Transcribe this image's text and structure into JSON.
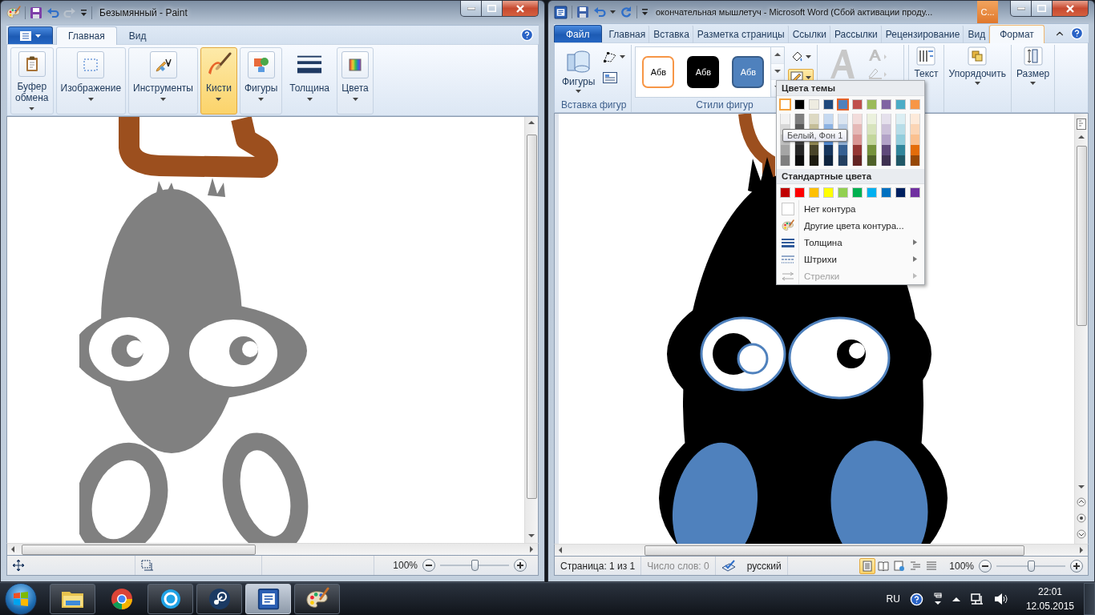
{
  "paint": {
    "title": "Безымянный - Paint",
    "tabs": [
      {
        "label": "Главная",
        "selected": true
      },
      {
        "label": "Вид",
        "selected": false
      }
    ],
    "groups": [
      {
        "label": "Буфер обмена",
        "kind": "clipboard",
        "selected": false
      },
      {
        "label": "Изображение",
        "kind": "select",
        "selected": false
      },
      {
        "label": "Инструменты",
        "kind": "tools",
        "selected": false
      },
      {
        "label": "Кисти",
        "kind": "brush",
        "selected": true
      },
      {
        "label": "Фигуры",
        "kind": "shapes",
        "selected": false
      },
      {
        "label": "Толщина",
        "kind": "size",
        "selected": false
      },
      {
        "label": "Цвета",
        "kind": "colors",
        "selected": false
      }
    ],
    "zoom": {
      "reading": "100%",
      "level": 0.5
    }
  },
  "word": {
    "title": "окончательная мышлетуч  -  Microsoft Word (Сбой активации проду...",
    "context_tab": "С...",
    "tabs": [
      {
        "label": "Файл",
        "kind": "file",
        "selected": false
      },
      {
        "label": "Главная",
        "kind": "normal",
        "selected": false
      },
      {
        "label": "Вставка",
        "kind": "normal",
        "selected": false
      },
      {
        "label": "Разметка страницы",
        "kind": "normal",
        "selected": false
      },
      {
        "label": "Ссылки",
        "kind": "normal",
        "selected": false
      },
      {
        "label": "Рассылки",
        "kind": "normal",
        "selected": false
      },
      {
        "label": "Рецензирование",
        "kind": "normal",
        "selected": false
      },
      {
        "label": "Вид",
        "kind": "normal",
        "selected": false
      },
      {
        "label": "Формат",
        "kind": "context",
        "selected": true
      }
    ],
    "insert_group": {
      "label": "Вставка фигур",
      "button": "Фигуры"
    },
    "styles_group": {
      "label": "Стили фигур",
      "styles": [
        {
          "text": "Абв",
          "kind": "outline"
        },
        {
          "text": "Абв",
          "kind": "black"
        },
        {
          "text": "Абв",
          "kind": "blue"
        }
      ]
    },
    "buttons": [
      {
        "label": "Текст",
        "kind": "text"
      },
      {
        "label": "Упорядочить",
        "kind": "arrange"
      },
      {
        "label": "Размер",
        "kind": "size"
      }
    ],
    "outline_menu": {
      "open": true,
      "theme_title": "Цвета темы",
      "theme_colors": [
        {
          "color": "#ffffff",
          "selected": false,
          "hovered": true,
          "shades": [
            {
              "color": "#f2f2f2"
            },
            {
              "color": "#d8d8d8"
            },
            {
              "color": "#bfbfbf"
            },
            {
              "color": "#a5a5a5"
            },
            {
              "color": "#7f7f7f"
            }
          ]
        },
        {
          "color": "#000000",
          "selected": false,
          "hovered": false,
          "shades": [
            {
              "color": "#7f7f7f"
            },
            {
              "color": "#595959"
            },
            {
              "color": "#3f3f3f"
            },
            {
              "color": "#262626"
            },
            {
              "color": "#0c0c0c"
            }
          ]
        },
        {
          "color": "#eeece1",
          "selected": false,
          "hovered": false,
          "shades": [
            {
              "color": "#ddd9c3"
            },
            {
              "color": "#c4bd97"
            },
            {
              "color": "#938953"
            },
            {
              "color": "#494429"
            },
            {
              "color": "#1d1b10"
            }
          ]
        },
        {
          "color": "#1f497d",
          "selected": false,
          "hovered": false,
          "shades": [
            {
              "color": "#c6d9f0"
            },
            {
              "color": "#8db3e2"
            },
            {
              "color": "#548dd4"
            },
            {
              "color": "#17365d"
            },
            {
              "color": "#0f243e"
            }
          ]
        },
        {
          "color": "#4f81bd",
          "selected": true,
          "hovered": false,
          "shades": [
            {
              "color": "#dbe5f1"
            },
            {
              "color": "#b8cce4"
            },
            {
              "color": "#95b3d7"
            },
            {
              "color": "#366092"
            },
            {
              "color": "#244061"
            }
          ]
        },
        {
          "color": "#c0504d",
          "selected": false,
          "hovered": false,
          "shades": [
            {
              "color": "#f2dcdb"
            },
            {
              "color": "#e5b9b7"
            },
            {
              "color": "#d99694"
            },
            {
              "color": "#953734"
            },
            {
              "color": "#632423"
            }
          ]
        },
        {
          "color": "#9bbb59",
          "selected": false,
          "hovered": false,
          "shades": [
            {
              "color": "#ebf1dd"
            },
            {
              "color": "#d7e3bc"
            },
            {
              "color": "#c3d69b"
            },
            {
              "color": "#76923c"
            },
            {
              "color": "#4f6128"
            }
          ]
        },
        {
          "color": "#8064a2",
          "selected": false,
          "hovered": false,
          "shades": [
            {
              "color": "#e5e0ec"
            },
            {
              "color": "#ccc1d9"
            },
            {
              "color": "#b2a2c7"
            },
            {
              "color": "#5f497a"
            },
            {
              "color": "#3f3151"
            }
          ]
        },
        {
          "color": "#4bacc6",
          "selected": false,
          "hovered": false,
          "shades": [
            {
              "color": "#dbeef3"
            },
            {
              "color": "#b7dde8"
            },
            {
              "color": "#92cddc"
            },
            {
              "color": "#31859b"
            },
            {
              "color": "#205867"
            }
          ]
        },
        {
          "color": "#f79646",
          "selected": false,
          "hovered": false,
          "shades": [
            {
              "color": "#fdeada"
            },
            {
              "color": "#fbd5b5"
            },
            {
              "color": "#fac08f"
            },
            {
              "color": "#e36c09"
            },
            {
              "color": "#974806"
            }
          ]
        }
      ],
      "tooltip": "Белый, Фон 1",
      "standard_title": "Стандартные цвета",
      "standard_colors": [
        {
          "color": "#c00000"
        },
        {
          "color": "#ff0000"
        },
        {
          "color": "#ffc000"
        },
        {
          "color": "#ffff00"
        },
        {
          "color": "#92d050"
        },
        {
          "color": "#00b050"
        },
        {
          "color": "#00b0f0"
        },
        {
          "color": "#0070c0"
        },
        {
          "color": "#002060"
        },
        {
          "color": "#7030a0"
        }
      ],
      "items": [
        {
          "label": "Нет контура",
          "kind": "none",
          "submenu": false,
          "disabled": false
        },
        {
          "label": "Другие цвета контура...",
          "kind": "more",
          "submenu": false,
          "disabled": false
        },
        {
          "label": "Толщина",
          "kind": "weight",
          "submenu": true,
          "disabled": false
        },
        {
          "label": "Штрихи",
          "kind": "dashes",
          "submenu": true,
          "disabled": false
        },
        {
          "label": "Стрелки",
          "kind": "arrows",
          "submenu": true,
          "disabled": true
        }
      ]
    },
    "status": {
      "sections": [
        {
          "text": "Страница: 1 из 1",
          "disabled": false
        },
        {
          "text": "Число слов: 0",
          "disabled": true
        }
      ],
      "language": "русский",
      "views": [
        {
          "kind": "print",
          "selected": true
        },
        {
          "kind": "reading",
          "selected": false
        },
        {
          "kind": "web",
          "selected": false
        },
        {
          "kind": "outline",
          "selected": false
        },
        {
          "kind": "draft",
          "selected": false
        }
      ],
      "zoom": {
        "reading": "100%",
        "level": 0.5
      }
    }
  },
  "taskbar": {
    "apps": [
      {
        "kind": "explorer",
        "running": true,
        "active": false
      },
      {
        "kind": "chrome",
        "running": false,
        "active": false
      },
      {
        "kind": "skype",
        "running": true,
        "active": false
      },
      {
        "kind": "steam",
        "running": true,
        "active": false
      },
      {
        "kind": "word",
        "running": true,
        "active": true
      },
      {
        "kind": "paint",
        "running": true,
        "active": false
      }
    ],
    "language": "RU",
    "time": "22:01",
    "date": "12.05.2015"
  }
}
